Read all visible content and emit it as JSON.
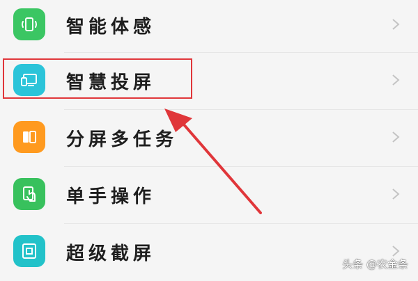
{
  "settings_items": [
    {
      "label": "智能体感",
      "icon": "phone-motion-icon",
      "color": "#3bc663"
    },
    {
      "label": "智慧投屏",
      "icon": "screen-cast-icon",
      "color": "#2bc4d9"
    },
    {
      "label": "分屏多任务",
      "icon": "split-screen-icon",
      "color": "#ff9a1f"
    },
    {
      "label": "单手操作",
      "icon": "one-hand-icon",
      "color": "#38c15d"
    },
    {
      "label": "超级截屏",
      "icon": "screenshot-icon",
      "color": "#22c2c9"
    }
  ],
  "annotation": {
    "highlight_color": "#e0363a",
    "highlighted_item": "智慧投屏"
  },
  "watermark": {
    "text": "头条 @农金条"
  }
}
